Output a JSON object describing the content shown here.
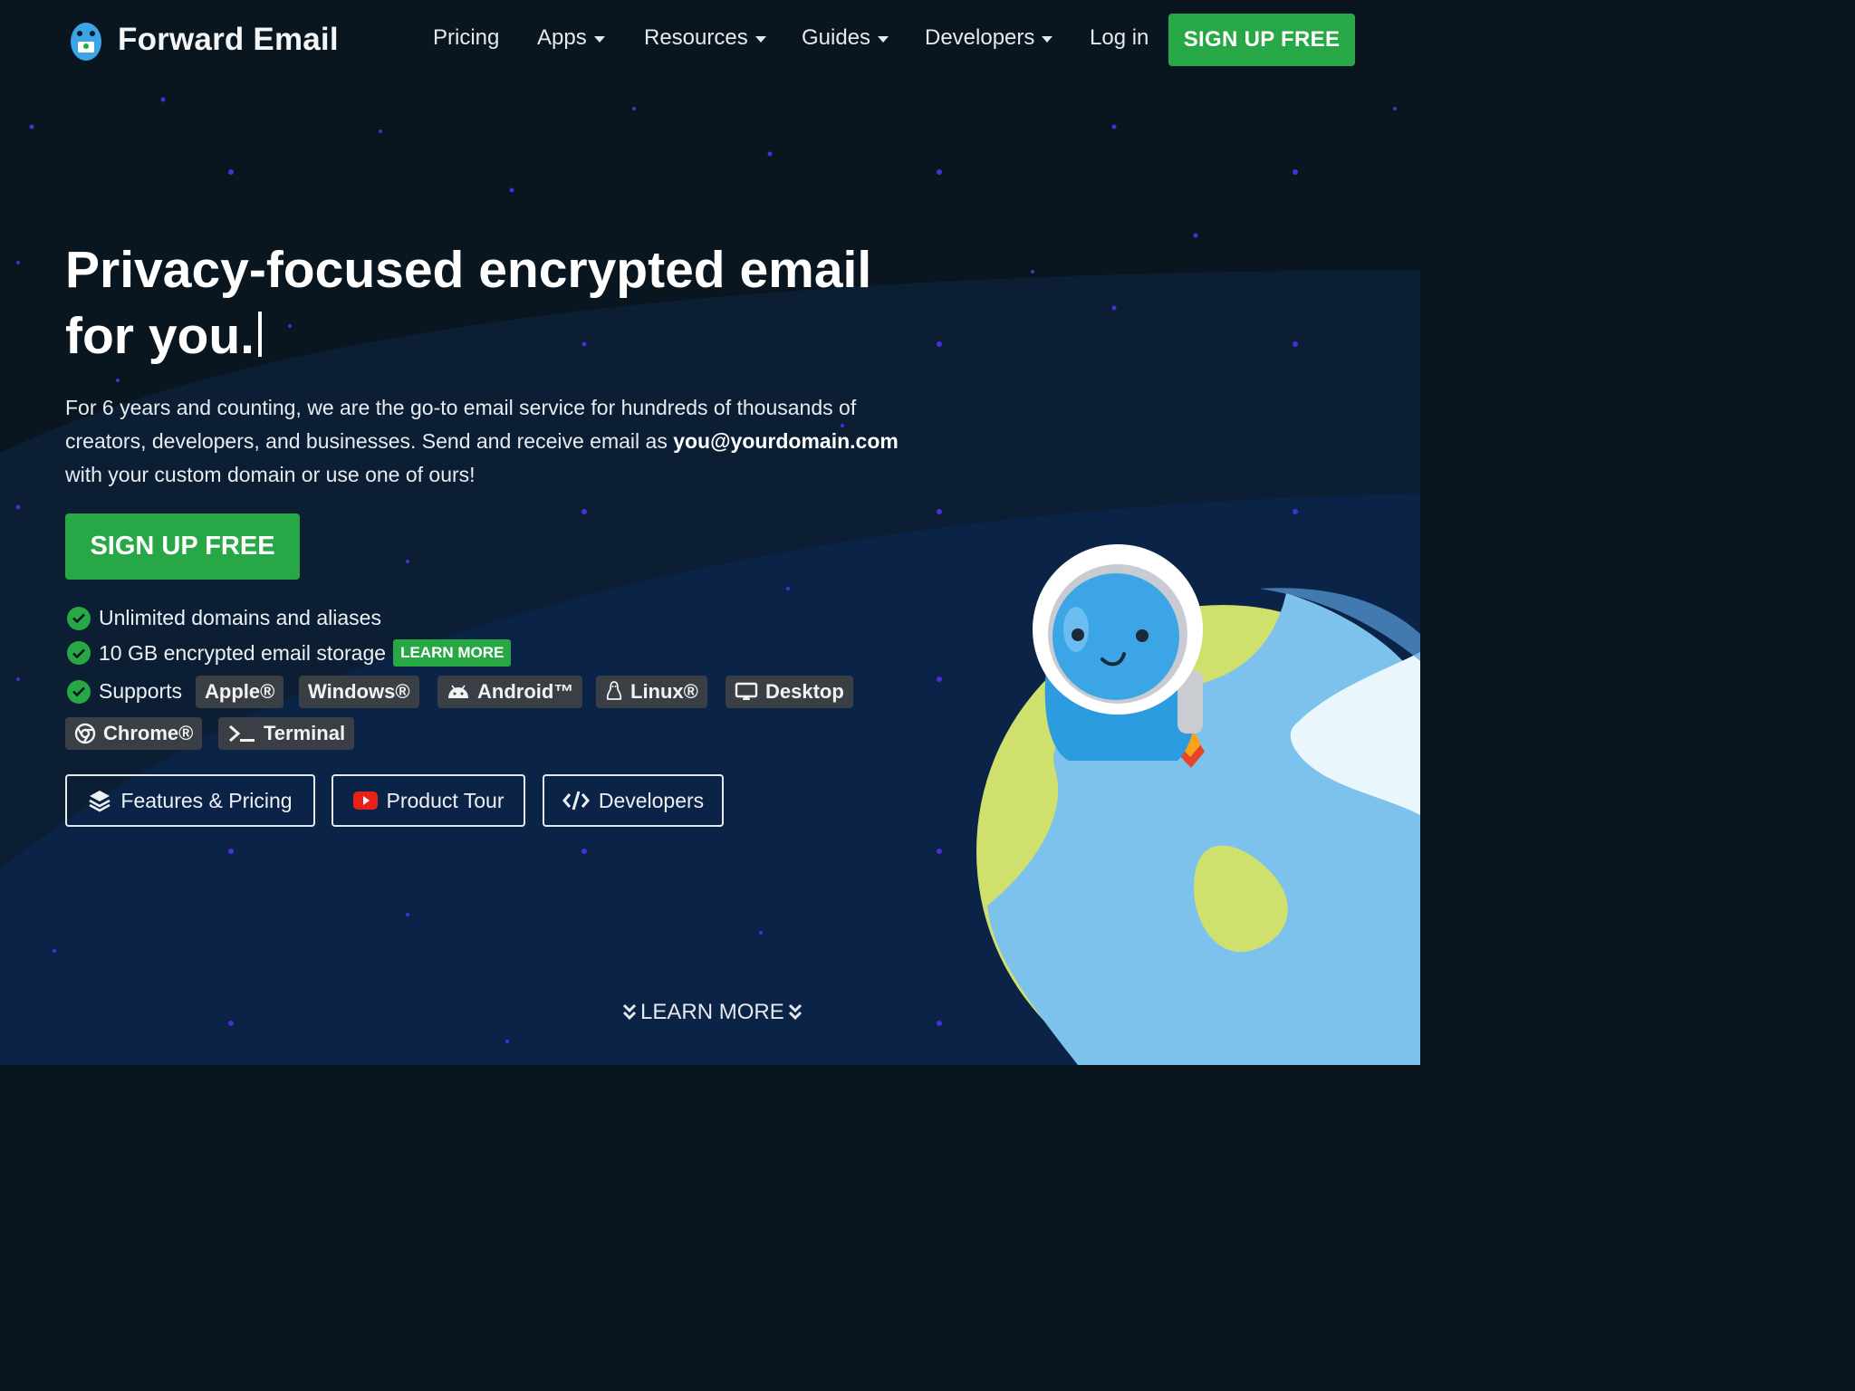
{
  "brand": {
    "name": "Forward Email"
  },
  "nav": {
    "pricing": "Pricing",
    "apps": "Apps",
    "resources": "Resources",
    "guides": "Guides",
    "developers": "Developers",
    "login": "Log in",
    "signup": "SIGN UP FREE"
  },
  "hero": {
    "title": "Privacy-focused encrypted email for you.",
    "desc_before": "For 6 years and counting, we are the go-to email service for hundreds of thousands of creators, developers, and businesses. Send and receive email as ",
    "desc_bold": "you@yourdomain.com",
    "desc_after": " with your custom domain or use one of ours!",
    "cta": "SIGN UP FREE"
  },
  "features": {
    "item1": "Unlimited domains and aliases",
    "item2": "10 GB encrypted email storage",
    "learn_more_badge": "LEARN MORE",
    "supports": "Supports"
  },
  "platforms": [
    "Apple®",
    "Windows®",
    "Android™",
    "Linux®",
    "Desktop",
    "Chrome®",
    "Terminal"
  ],
  "buttons": {
    "features_pricing": "Features & Pricing",
    "product_tour": "Product Tour",
    "developers": "Developers"
  },
  "learn_more": "LEARN MORE",
  "colors": {
    "background": "#09151f",
    "wave": "#0a2244",
    "accent_green": "#27a745",
    "planet_blue": "#7dc1ed",
    "planet_green": "#d0e06c"
  }
}
